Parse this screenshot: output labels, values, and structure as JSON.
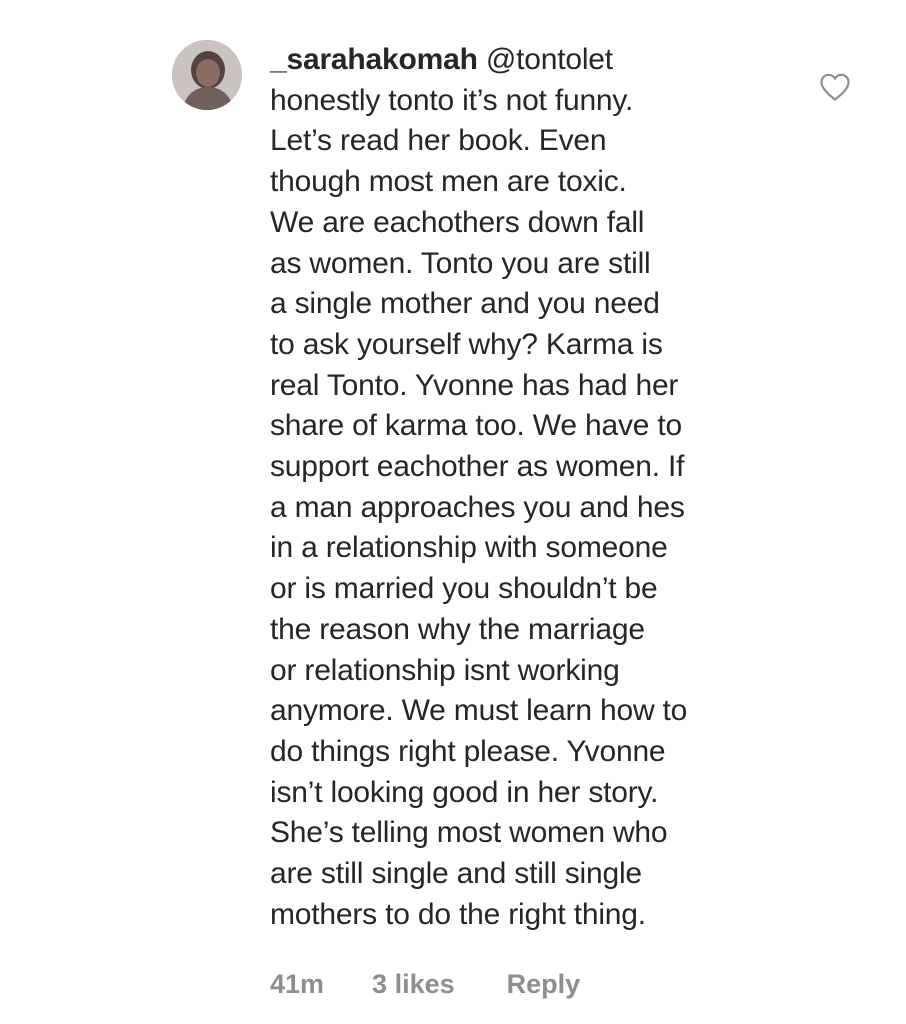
{
  "comment": {
    "username": "_sarahakomah",
    "mention": "@tontolet",
    "lines": [
      "honestly tonto it’s not funny.",
      "Let’s read her book. Even",
      "though most men are toxic.",
      "We are eachothers down fall",
      "as women. Tonto you are still",
      "a single mother and you need",
      "to ask yourself why? Karma is",
      "real Tonto. Yvonne has had her",
      "share of karma too. We have to",
      "support eachother as women. If",
      "a man approaches you and hes",
      "in a relationship with someone",
      "or is married you shouldn’t be",
      "the reason why the marriage",
      "or relationship isnt working",
      "anymore. We must learn how to",
      "do things right please. Yvonne",
      "isn’t looking good in her story.",
      "She’s telling most women who",
      "are still single and still single",
      "mothers to do the right thing."
    ],
    "time": "41m",
    "likes": "3 likes",
    "reply": "Reply"
  },
  "icons": {
    "like": "heart-outline-icon",
    "avatar": "profile-avatar"
  },
  "colors": {
    "text": "#262626",
    "meta": "#8e8e8e",
    "background": "#ffffff"
  }
}
